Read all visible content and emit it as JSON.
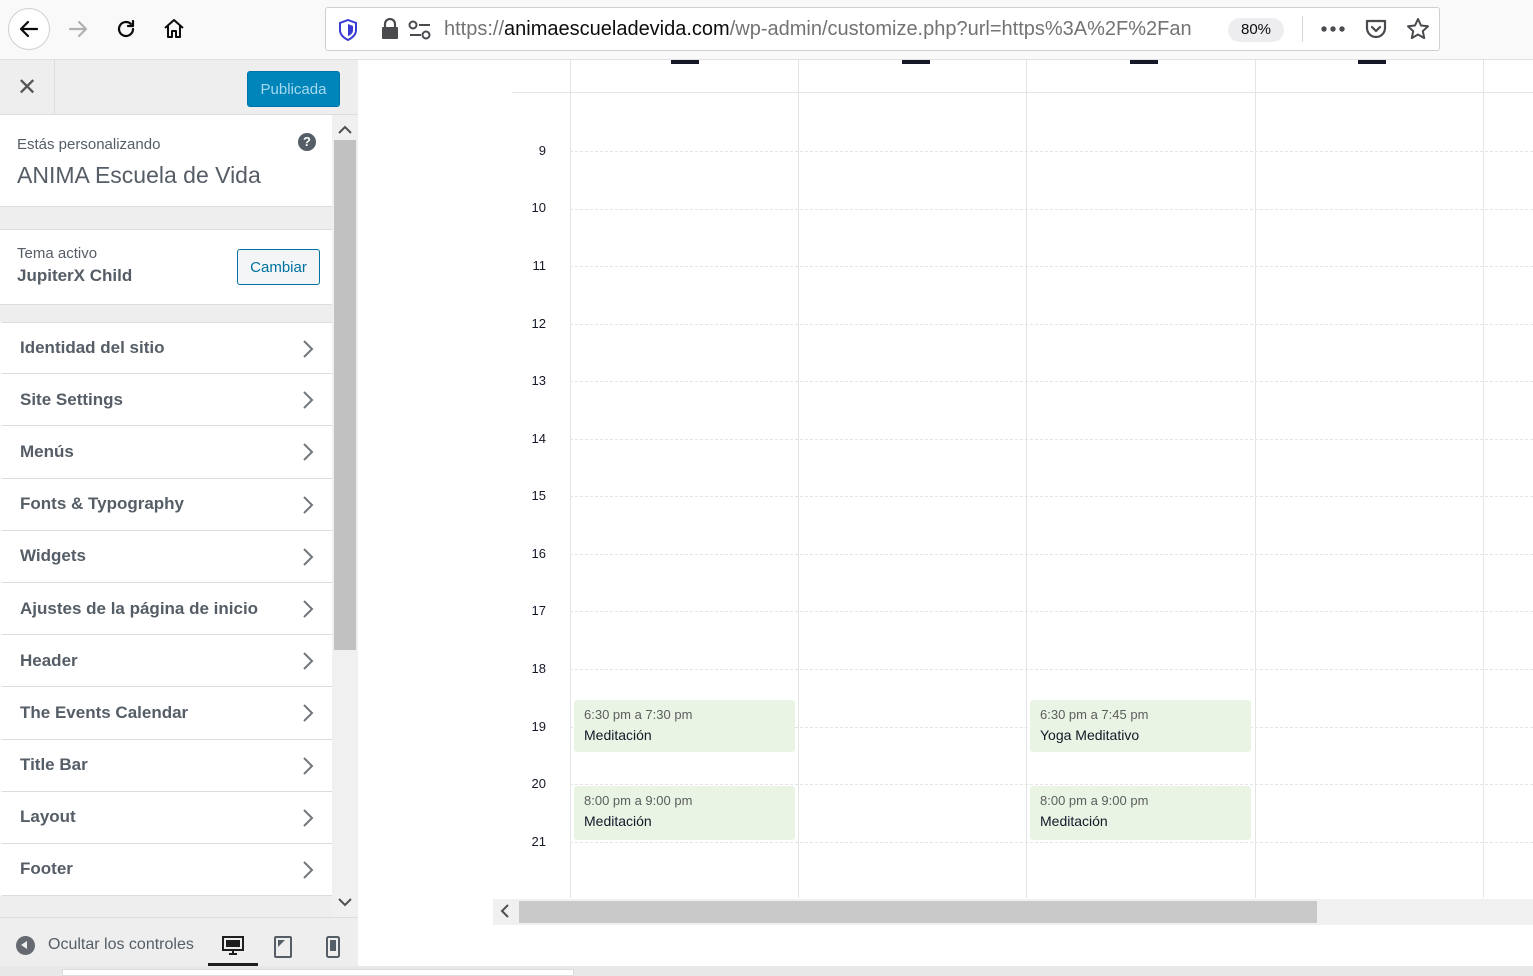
{
  "browser": {
    "url_prefix": "https://",
    "url_domain": "animaescueladevida.com",
    "url_path": "/wp-admin/customize.php?url=https%3A%2F%2Fan",
    "zoom": "80%"
  },
  "customizer": {
    "publish_label": "Publicada",
    "customizing_kicker": "Estás personalizando",
    "site_title": "ANIMA Escuela de Vida",
    "theme_kicker": "Tema activo",
    "theme_name": "JupiterX Child",
    "change_label": "Cambiar",
    "panels": [
      {
        "label": "Identidad del sitio"
      },
      {
        "label": "Site Settings"
      },
      {
        "label": "Menús"
      },
      {
        "label": "Fonts & Typography"
      },
      {
        "label": "Widgets"
      },
      {
        "label": "Ajustes de la página de inicio"
      },
      {
        "label": "Header"
      },
      {
        "label": "The Events Calendar"
      },
      {
        "label": "Title Bar"
      },
      {
        "label": "Layout"
      },
      {
        "label": "Footer"
      }
    ],
    "collapse_label": "Ocultar los controles"
  },
  "calendar": {
    "hours": [
      "9",
      "10",
      "11",
      "12",
      "13",
      "14",
      "15",
      "16",
      "17",
      "18",
      "19",
      "20",
      "21"
    ],
    "events": [
      {
        "time": "6:30 pm a 7:30 pm",
        "title": "Meditación"
      },
      {
        "time": "8:00 pm a 9:00 pm",
        "title": "Meditación"
      },
      {
        "time": "6:30 pm a 7:45 pm",
        "title": "Yoga Meditativo"
      },
      {
        "time": "8:00 pm a 9:00 pm",
        "title": "Meditación"
      }
    ]
  },
  "colors": {
    "publish_bg": "#0085ba",
    "event_bg": "#e9f4e5",
    "sidebar_bg": "#eeeeee"
  }
}
